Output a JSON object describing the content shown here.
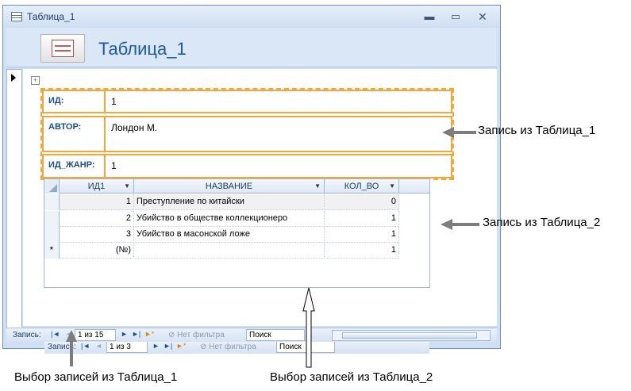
{
  "window": {
    "title": "Таблица_1",
    "form_title": "Таблица_1",
    "minimize": "▬",
    "maximize": "▭",
    "close": "✕"
  },
  "fields": [
    {
      "label": "ИД:",
      "value": "1"
    },
    {
      "label": "АВТОР:",
      "value": "Лондон М."
    },
    {
      "label": "ИД_ЖАНР:",
      "value": "1"
    }
  ],
  "subform": {
    "columns": [
      "ИД1",
      "НАЗВАНИЕ",
      "КОЛ_ВО"
    ],
    "rows": [
      {
        "id": "1",
        "name": "Преступление по китайски",
        "qty": "0"
      },
      {
        "id": "2",
        "name": "Убийство в обществе коллекционеро",
        "qty": "1"
      },
      {
        "id": "3",
        "name": "Убийство в масонской ложе",
        "qty": "1"
      }
    ],
    "new_row": {
      "marker": "*",
      "id": "(№)",
      "qty": "1"
    },
    "nav": {
      "label": "Запись:",
      "first": "|◄",
      "prev": "◄",
      "current": "1 из 3",
      "next": "►",
      "last": "►|",
      "new": "►*",
      "filter": "Нет фильтра",
      "search": "Поиск"
    }
  },
  "main_nav": {
    "label": "Запись:",
    "first": "|◄",
    "prev": "◄",
    "current": "1 из 15",
    "next": "►",
    "last": "►|",
    "new": "►*",
    "filter": "Нет фильтра",
    "search": "Поиск"
  },
  "annotations": {
    "record1": "Запись  из Таблица_1",
    "record2": "Запись из Таблица_2",
    "select1": "Выбор записей из Таблица_1",
    "select2": "Выбор записей из Таблица_2"
  },
  "colors": {
    "field_border": "#f3a73b",
    "label_text": "#1d4f8a",
    "title_text": "#1f5a9c",
    "window_bg": "#cfe0f4"
  }
}
